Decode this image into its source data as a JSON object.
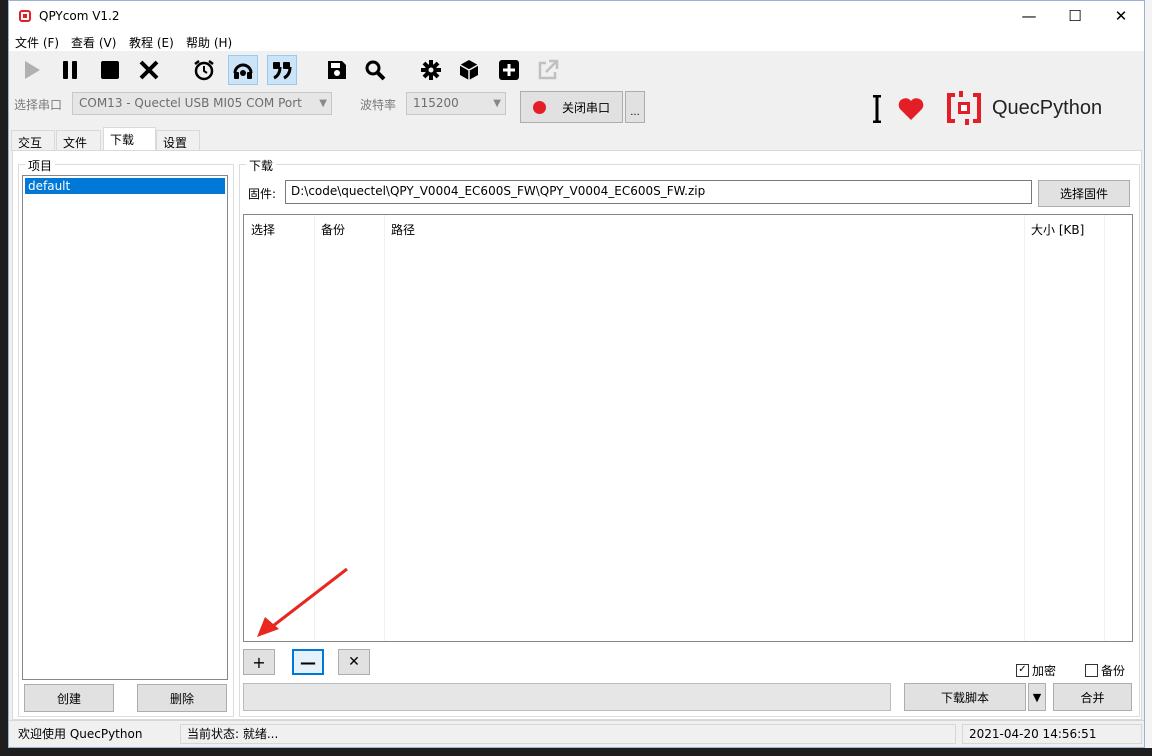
{
  "window": {
    "title": "QPYcom V1.2",
    "minimize": "—",
    "maximize": "☐",
    "close": "✕"
  },
  "menu": [
    "文件 (F)",
    "查看 (V)",
    "教程 (E)",
    "帮助 (H)"
  ],
  "toolbar": {
    "icons": [
      "play-icon",
      "pause-icon",
      "stop-icon",
      "close-icon",
      "alarm-clock-icon",
      "headset-icon",
      "quote-icon",
      "save-icon",
      "search-icon",
      "settings-icon",
      "cube-icon",
      "add-icon",
      "external-link-icon"
    ]
  },
  "port": {
    "label": "选择串口",
    "value": "COM13 - Quectel USB MI05 COM Port",
    "baud_label": "波特率",
    "baud_value": "115200",
    "toggle_label": "关闭串口",
    "more_label": "..."
  },
  "brand": {
    "name": "QuecPython",
    "accent": "#e41e26"
  },
  "tabs": [
    {
      "label": "交互",
      "selected": false
    },
    {
      "label": "文件",
      "selected": false
    },
    {
      "label": "下载",
      "selected": true
    },
    {
      "label": "设置",
      "selected": false
    }
  ],
  "project": {
    "group_title": "项目",
    "items": [
      "default"
    ],
    "create_label": "创建",
    "delete_label": "删除"
  },
  "download": {
    "group_title": "下载",
    "firmware_label": "固件:",
    "firmware_path": "D:\\code\\quectel\\QPY_V0004_EC600S_FW\\QPY_V0004_EC600S_FW.zip",
    "select_firmware_label": "选择固件",
    "columns": [
      "选择",
      "备份",
      "路径",
      "大小 [KB]"
    ],
    "add_label": "+",
    "remove_label": "—",
    "clear_label": "✕",
    "encrypt_label": "加密",
    "encrypt_checked": true,
    "backup_label": "备份",
    "backup_checked": false,
    "download_script_label": "下载脚本",
    "dropdown_arrow": "▼",
    "merge_label": "合并"
  },
  "status": {
    "welcome": "欢迎使用 QuecPython",
    "state": "当前状态: 就绪...",
    "datetime": "2021-04-20 14:56:51"
  }
}
